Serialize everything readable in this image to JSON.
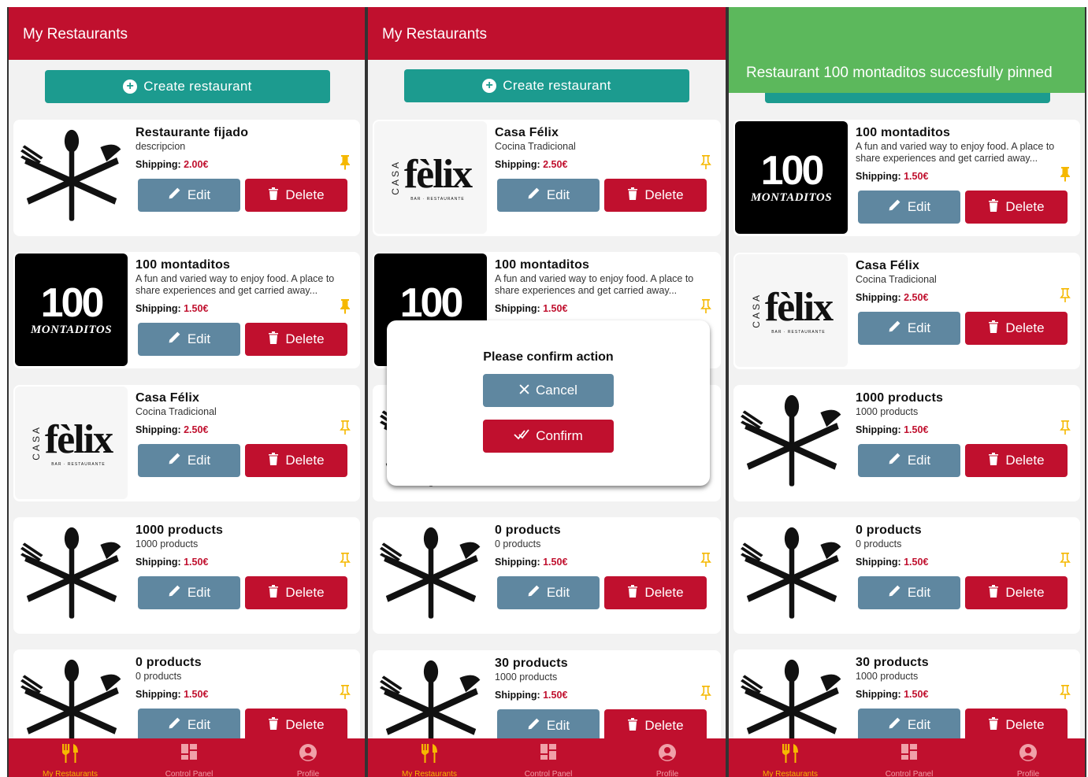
{
  "colors": {
    "header": "#c0102e",
    "create_button": "#1c9b8f",
    "edit_button": "#5f87a0",
    "delete_button": "#c0102e",
    "price": "#c0102e",
    "pin": "#f5b800",
    "toast": "#5cb85c"
  },
  "header": {
    "title": "My Restaurants"
  },
  "create_button": {
    "label": "Create restaurant",
    "icon": "plus-circle-icon"
  },
  "card_labels": {
    "shipping": "Shipping:",
    "edit": "Edit",
    "delete": "Delete"
  },
  "logo_text": {
    "felix_casa": "CASA",
    "felix_word": "fèlix",
    "felix_sub": "BAR · RESTAURANTE",
    "montaditos_num": "100",
    "montaditos_word": "MONTADITOS"
  },
  "screens": [
    {
      "restaurants": [
        {
          "name": "Restaurante fijado",
          "description": "descripcion",
          "shipping": "2.00€",
          "logo": "cutlery",
          "pinned": true
        },
        {
          "name": "100 montaditos",
          "description": "A fun and varied way to enjoy food. A place to share experiences and get carried away...",
          "shipping": "1.50€",
          "logo": "100-montaditos",
          "pinned": true
        },
        {
          "name": "Casa Félix",
          "description": "Cocina Tradicional",
          "shipping": "2.50€",
          "logo": "casa-felix",
          "pinned": false
        },
        {
          "name": "1000 products",
          "description": "1000 products",
          "shipping": "1.50€",
          "logo": "cutlery",
          "pinned": false
        },
        {
          "name": "0 products",
          "description": "0 products",
          "shipping": "1.50€",
          "logo": "cutlery",
          "pinned": false
        }
      ]
    },
    {
      "restaurants": [
        {
          "name": "Casa Félix",
          "description": "Cocina Tradicional",
          "shipping": "2.50€",
          "logo": "casa-felix",
          "pinned": false
        },
        {
          "name": "100 montaditos",
          "description": "A fun and varied way to enjoy food. A place to share experiences and get carried away...",
          "shipping": "1.50€",
          "logo": "100-montaditos",
          "pinned": false
        },
        {
          "name": "",
          "description": "",
          "shipping": "",
          "logo": "cutlery",
          "pinned": false
        },
        {
          "name": "0 products",
          "description": "0 products",
          "shipping": "1.50€",
          "logo": "cutlery",
          "pinned": false
        },
        {
          "name": "30 products",
          "description": "1000 products",
          "shipping": "1.50€",
          "logo": "cutlery",
          "pinned": false
        }
      ],
      "modal": {
        "title": "Please confirm action",
        "cancel": "Cancel",
        "confirm": "Confirm"
      }
    },
    {
      "toast": "Restaurant 100 montaditos succesfully pinned",
      "restaurants": [
        {
          "name": "100 montaditos",
          "description": "A fun and varied way to enjoy food. A place to share experiences and get carried away...",
          "shipping": "1.50€",
          "logo": "100-montaditos",
          "pinned": true
        },
        {
          "name": "Casa Félix",
          "description": "Cocina Tradicional",
          "shipping": "2.50€",
          "logo": "casa-felix",
          "pinned": false
        },
        {
          "name": "1000 products",
          "description": "1000 products",
          "shipping": "1.50€",
          "logo": "cutlery",
          "pinned": false
        },
        {
          "name": "0 products",
          "description": "0 products",
          "shipping": "1.50€",
          "logo": "cutlery",
          "pinned": false
        },
        {
          "name": "30 products",
          "description": "1000 products",
          "shipping": "1.50€",
          "logo": "cutlery",
          "pinned": false
        }
      ]
    }
  ],
  "tabbar": {
    "items": [
      {
        "label": "My Restaurants",
        "icon": "cutlery-icon",
        "active": true
      },
      {
        "label": "Control Panel",
        "icon": "grid-icon",
        "active": false
      },
      {
        "label": "Profile",
        "icon": "user-circle-icon",
        "active": false
      }
    ]
  }
}
